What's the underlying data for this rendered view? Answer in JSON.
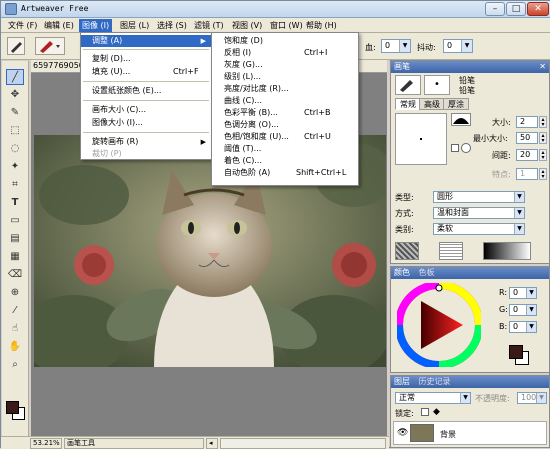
{
  "window": {
    "title": "Artweaver Free",
    "min_label": "–",
    "max_label": "□",
    "close_label": "✕"
  },
  "menubar": [
    {
      "label": "文件 (F)"
    },
    {
      "label": "编辑 (E)"
    },
    {
      "label": "图像 (I)"
    },
    {
      "label": "图层 (L)"
    },
    {
      "label": "选择 (S)"
    },
    {
      "label": "滤镜 (T)"
    },
    {
      "label": "视图 (V)"
    },
    {
      "label": "窗口 (W)"
    },
    {
      "label": "帮助 (H)"
    }
  ],
  "toolbar": {
    "blend_label": "血:",
    "blend_value": "0",
    "jitter_label": "抖动:",
    "jitter_value": "0"
  },
  "document": {
    "title": "6597769050",
    "zoom": "53.21%",
    "tool_status": "画笔工具"
  },
  "image_menu": {
    "items": [
      {
        "label": "调整 (A)",
        "shortcut": "",
        "submenu": true,
        "highlight": true
      },
      {
        "label": "复制 (D)...",
        "shortcut": ""
      },
      {
        "label": "填充 (U)...",
        "shortcut": "Ctrl+F"
      },
      {
        "label": "设置纸张颜色 (E)...",
        "shortcut": ""
      },
      {
        "label": "画布大小 (C)...",
        "shortcut": ""
      },
      {
        "label": "图像大小 (I)...",
        "shortcut": ""
      },
      {
        "label": "旋转画布 (R)",
        "shortcut": "",
        "submenu": true
      },
      {
        "label": "裁切 (P)",
        "shortcut": "",
        "disabled": true
      }
    ]
  },
  "adjust_submenu": {
    "items": [
      {
        "label": "饱和度 (D)",
        "shortcut": ""
      },
      {
        "label": "反相 (I)",
        "shortcut": "Ctrl+I"
      },
      {
        "label": "灰度 (G)...",
        "shortcut": ""
      },
      {
        "label": "级别 (L)...",
        "shortcut": ""
      },
      {
        "label": "亮度/对比度 (R)...",
        "shortcut": ""
      },
      {
        "label": "曲线 (C)...",
        "shortcut": ""
      },
      {
        "label": "色彩平衡 (B)...",
        "shortcut": "Ctrl+B"
      },
      {
        "label": "色调分离 (O)...",
        "shortcut": ""
      },
      {
        "label": "色相/饱和度 (U)...",
        "shortcut": "Ctrl+U"
      },
      {
        "label": "阈值 (T)...",
        "shortcut": ""
      },
      {
        "label": "着色 (C)...",
        "shortcut": ""
      },
      {
        "label": "自动色阶 (A)",
        "shortcut": "Shift+Ctrl+L"
      }
    ]
  },
  "brush_panel": {
    "title": "画笔",
    "preset1": "铅笔",
    "preset2": "铅笔",
    "tabs": [
      "常规",
      "高级",
      "厚涂"
    ],
    "size_label": "大小:",
    "size_value": "2",
    "min_size_label": "最小大小:",
    "min_size_value": "50",
    "spacing_label": "间距:",
    "spacing_value": "20",
    "feature_label": "特点:",
    "feature_value": "1",
    "type_label": "类型:",
    "type_value": "圆形",
    "mode_label": "方式:",
    "mode_value": "温和封面",
    "category_label": "类别:",
    "category_value": "柔软"
  },
  "color_panel": {
    "tabs": [
      "颜色",
      "色板"
    ],
    "r_label": "R:",
    "r_value": "0",
    "g_label": "G:",
    "g_value": "0",
    "b_label": "B:",
    "b_value": "0"
  },
  "layers_panel": {
    "tabs": [
      "图层",
      "历史记录"
    ],
    "blend_mode": "正常",
    "opacity_label": "不透明度:",
    "opacity_value": "100",
    "lock_label": "锁定:",
    "layer_name": "背景"
  },
  "colors": {
    "accent": "#316ac5",
    "fg": "#000000",
    "bg": "#ffffff",
    "fg_swatch": "#3a1a16"
  }
}
